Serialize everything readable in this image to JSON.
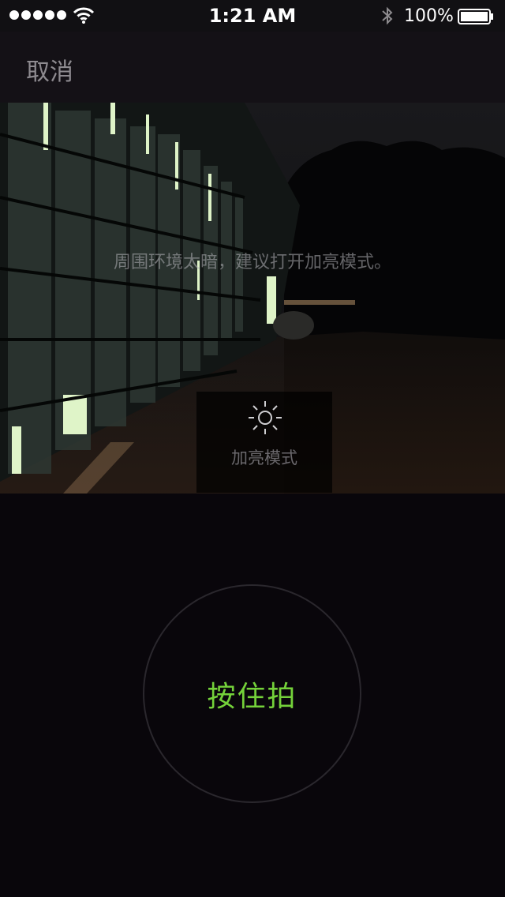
{
  "status_bar": {
    "time": "1:21 AM",
    "battery": "100%",
    "signal_icon": "signal-dots-icon",
    "wifi_icon": "wifi-icon",
    "bluetooth_icon": "bluetooth-icon",
    "battery_icon": "battery-icon"
  },
  "nav": {
    "cancel_label": "取消"
  },
  "preview": {
    "hint_text": "周围环境太暗，建议打开加亮模式。",
    "brighten_label": "加亮模式",
    "brighten_icon": "sun-icon"
  },
  "capture": {
    "shutter_label": "按住拍"
  },
  "colors": {
    "accent_green": "#74d13a",
    "background": "#09060b"
  }
}
